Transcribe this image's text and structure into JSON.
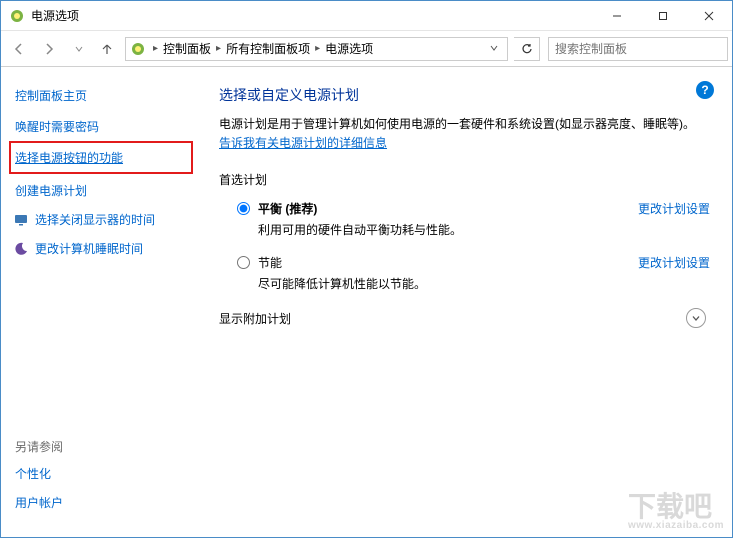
{
  "window": {
    "title": "电源选项"
  },
  "breadcrumb": {
    "items": [
      "控制面板",
      "所有控制面板项",
      "电源选项"
    ]
  },
  "search": {
    "placeholder": "搜索控制面板"
  },
  "sidebar": {
    "home": "控制面板主页",
    "links": [
      "唤醒时需要密码",
      "选择电源按钮的功能",
      "创建电源计划",
      "选择关闭显示器的时间",
      "更改计算机睡眠时间"
    ],
    "see_also_title": "另请参阅",
    "see_also": [
      "个性化",
      "用户帐户"
    ]
  },
  "main": {
    "heading": "选择或自定义电源计划",
    "description": "电源计划是用于管理计算机如何使用电源的一套硬件和系统设置(如显示器亮度、睡眠等)。",
    "description_link": "告诉我有关电源计划的详细信息",
    "preferred_title": "首选计划",
    "plans": [
      {
        "name": "平衡 (推荐)",
        "desc": "利用可用的硬件自动平衡功耗与性能。",
        "selected": true,
        "change": "更改计划设置"
      },
      {
        "name": "节能",
        "desc": "尽可能降低计算机性能以节能。",
        "selected": false,
        "change": "更改计划设置"
      }
    ],
    "additional_title": "显示附加计划"
  },
  "watermark": {
    "text": "下载吧",
    "url": "www.xiazaiba.com"
  }
}
